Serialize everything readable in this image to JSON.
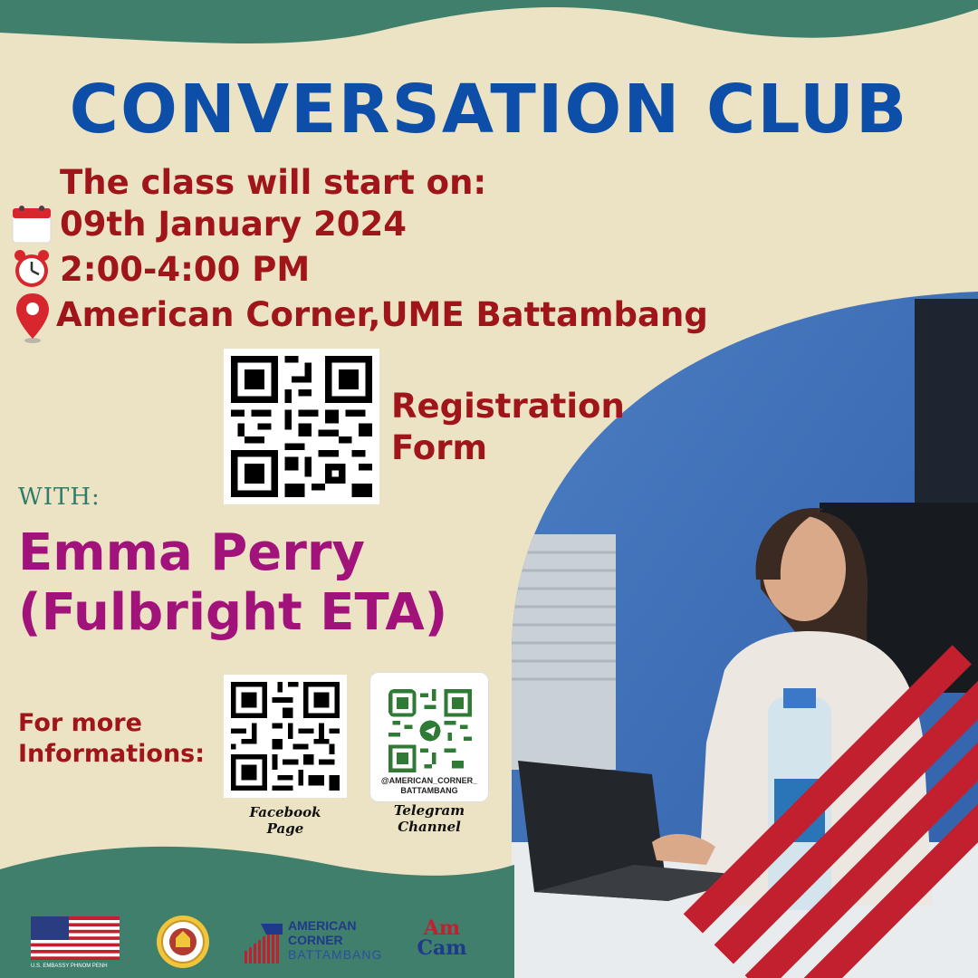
{
  "title": "CONVERSATION CLUB",
  "schedule": {
    "intro": "The class will start on:",
    "date": "09th January 2024",
    "time": "2:00-4:00 PM",
    "location": "American Corner,UME Battambang",
    "icons": [
      "calendar-icon",
      "alarm-clock-icon",
      "location-pin-icon"
    ]
  },
  "registration": {
    "line1": "Registration",
    "line2": "Form"
  },
  "with_label": "WITH:",
  "guest": {
    "name": "Emma Perry",
    "role": "(Fulbright ETA)"
  },
  "more_info": {
    "line1": "For more",
    "line2": "Informations:"
  },
  "qr_codes": {
    "facebook": {
      "caption_line1": "Facebook",
      "caption_line2": "Page"
    },
    "telegram": {
      "handle_line1": "@AMERICAN_CORNER_",
      "handle_line2": "BATTAMBANG",
      "caption_line1": "Telegram",
      "caption_line2": "Channel"
    }
  },
  "logos": {
    "embassy": "U.S. EMBASSY PHNOM PENH",
    "american_corner_line1": "AMERICAN",
    "american_corner_line2": "CORNER",
    "american_corner_line3": "BATTAMBANG",
    "amcam_line1": "Am",
    "amcam_line2": "Cam"
  },
  "colors": {
    "background": "#ece3c4",
    "teal": "#3f7f6c",
    "title_blue": "#0d4fa8",
    "info_red": "#a01519",
    "guest_magenta": "#a1127a",
    "stripe_red": "#c3202f"
  }
}
